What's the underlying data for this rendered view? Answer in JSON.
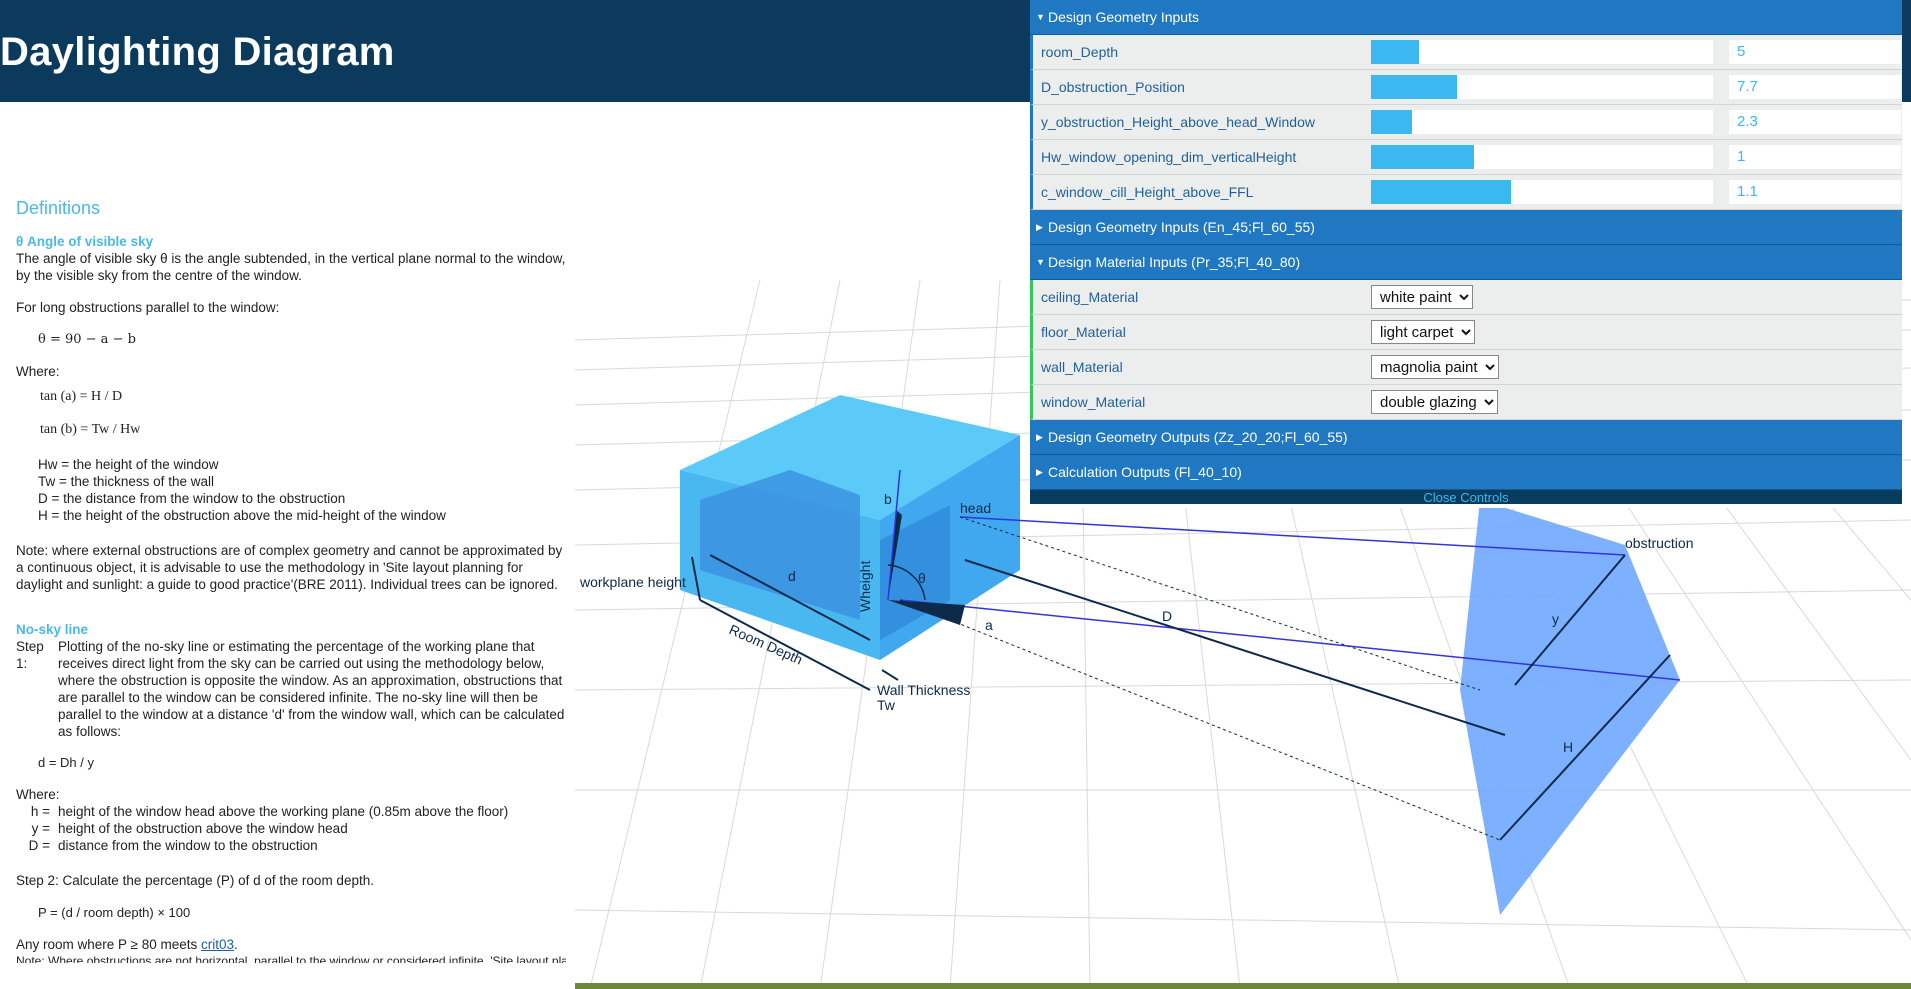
{
  "header": {
    "title": "Daylighting Diagram"
  },
  "definitions": {
    "title": "Definitions",
    "angle": {
      "heading": "θ  Angle of visible sky",
      "desc": "The angle of visible sky θ is the angle subtended, in the vertical plane normal to the window, by the visible sky from the centre of the window.",
      "long_obs": "For long obstructions parallel to the window:",
      "equation": "θ =  90  −  a  −  b",
      "where": "Where:",
      "tan_a": "tan (a) = H / D",
      "tan_b": "tan (b) = Tw / Hw",
      "vars": [
        "Hw = the height of the window",
        "Tw = the thickness of the wall",
        "D = the distance from the window to the obstruction",
        "H = the height of the obstruction above the mid-height of the window"
      ],
      "note": "Note: where external obstructions are of complex geometry and cannot be approximated by a continuous object, it is advisable to use the methodology in 'Site layout planning for daylight and sunlight: a guide to good practice'(BRE 2011). Individual trees can be ignored."
    },
    "nosky": {
      "heading": "No-sky line",
      "step1_label": "Step 1:",
      "step1": "Plotting of the no-sky line or estimating the percentage of the working plane that receives direct light from the sky can be carried out using the methodology below, where the obstruction is opposite the window. As an approximation, obstructions that are parallel to the window can be considered infinite. The no-sky line will then be parallel to the window at a distance 'd' from the window wall, which can be calculated as follows:",
      "formula": "d = Dh / y",
      "where": "Where:",
      "vars": [
        {
          "k": "h =",
          "v": "height of the window head above the working plane (0.85m above the floor)"
        },
        {
          "k": "y =",
          "v": "height of the obstruction above the window head"
        },
        {
          "k": "D =",
          "v": "distance from the window to the obstruction"
        }
      ],
      "step2": "Step 2:  Calculate the percentage (P) of d of the room depth.",
      "formula2": "P = (d / room depth) × 100",
      "crit_prefix": "Any room where P ≥ 80 meets ",
      "crit_link": "crit03",
      "crit_suffix": ".",
      "note_cut": "Note: Where obstructions are not horizontal, parallel to the window or considered infinite, 'Site layout planning"
    }
  },
  "panel": {
    "geometry_inputs": {
      "label": "Design Geometry Inputs",
      "rows": [
        {
          "name": "room_Depth",
          "value": "5",
          "fill": 0.14
        },
        {
          "name": "D_obstruction_Position",
          "value": "7.7",
          "fill": 0.25
        },
        {
          "name": "y_obstruction_Height_above_head_Window",
          "value": "2.3",
          "fill": 0.12
        },
        {
          "name": "Hw_window_opening_dim_verticalHeight",
          "value": "1",
          "fill": 0.3
        },
        {
          "name": "c_window_cill_Height_above_FFL",
          "value": "1.1",
          "fill": 0.41
        }
      ]
    },
    "geometry_inputs_2": {
      "label": "Design Geometry Inputs (En_45;Fl_60_55)"
    },
    "material_inputs": {
      "label": "Design Material Inputs (Pr_35;Fl_40_80)",
      "rows": [
        {
          "name": "ceiling_Material",
          "value": "white paint"
        },
        {
          "name": "floor_Material",
          "value": "light carpet"
        },
        {
          "name": "wall_Material",
          "value": "magnolia paint"
        },
        {
          "name": "window_Material",
          "value": "double glazing"
        }
      ]
    },
    "geometry_outputs": {
      "label": "Design Geometry Outputs (Zz_20_20;Fl_60_55)"
    },
    "calc_outputs": {
      "label": "Calculation Outputs (Fl_40_10)"
    },
    "close": "Close Controls"
  },
  "scene": {
    "labels": {
      "workplane": "workplane height",
      "d": "d",
      "room_depth": "Room Depth",
      "wheight": "Wheight",
      "b": "b",
      "head": "head",
      "theta": "θ",
      "a": "a",
      "D": "D",
      "wall_thickness": "Wall Thickness",
      "tw": "Tw",
      "obstruction": "obstruction",
      "y": "y",
      "H": "H"
    },
    "colors": {
      "room": "#4fc3f7",
      "room_dark": "#2f86d8",
      "obstruction": "#6fa8ff",
      "ray": "#3333dd",
      "dim": "#0d2a4a"
    }
  }
}
